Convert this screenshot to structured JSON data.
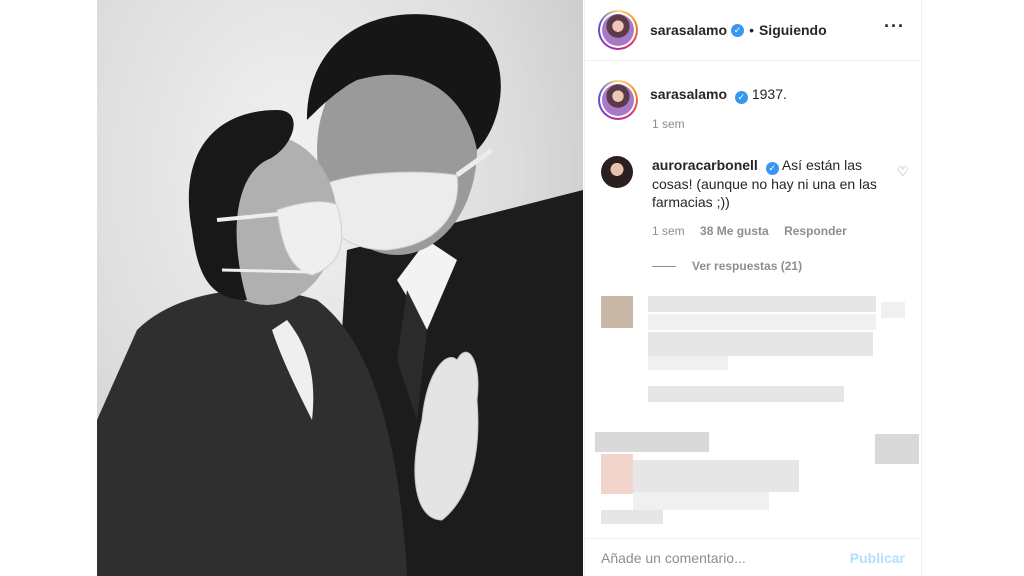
{
  "post": {
    "author": "sarasalamo",
    "separator": "•",
    "follow_status": "Siguiendo",
    "more_icon": "more-options-icon"
  },
  "caption": {
    "author": "sarasalamo",
    "text": "1937.",
    "time": "1 sem"
  },
  "comment": {
    "author": "auroracarbonell",
    "text": "Así están las cosas! (aunque no hay ni una en las farmacias ;))",
    "time": "1 sem",
    "likes": "38 Me gusta",
    "reply": "Responder",
    "view_replies": "Ver respuestas (21)"
  },
  "footer": {
    "placeholder": "Añade un comentario...",
    "publish": "Publicar"
  },
  "colors": {
    "verified": "#3897f0",
    "publish_disabled": "#b2dffc",
    "meta_text": "#8e8e8e"
  }
}
